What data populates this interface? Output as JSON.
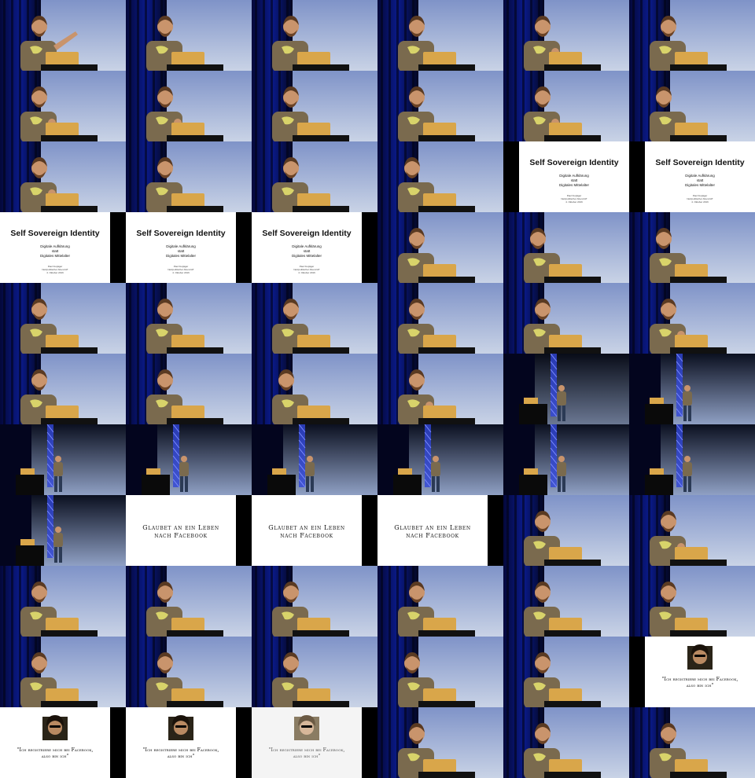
{
  "grid": {
    "columns": 6,
    "rows": 11
  },
  "slides": {
    "ssi": {
      "title": "Self Sovereign Identity",
      "subtitle_lines": [
        "Digitale Aufklärung",
        "statt",
        "Digitales Mittelalter"
      ],
      "meta_lines": [
        "Paul Fuxjäger",
        "Netzpolitischer Abend AT",
        "4. Oktober 2016"
      ]
    },
    "facebook_leben": {
      "lines": [
        "Glaubet an ein Leben",
        "nach Facebook"
      ]
    },
    "descartes": {
      "quote_lines": [
        "\"Ich registriere mich bei Facebook,",
        "also bin ich\""
      ]
    }
  },
  "frames": [
    {
      "kind": "speaker",
      "variant": "point"
    },
    {
      "kind": "speaker",
      "variant": "stand"
    },
    {
      "kind": "speaker",
      "variant": "stand"
    },
    {
      "kind": "speaker",
      "variant": "stand"
    },
    {
      "kind": "speaker",
      "variant": "gesture"
    },
    {
      "kind": "speaker",
      "variant": "stand"
    },
    {
      "kind": "speaker",
      "variant": "gesture"
    },
    {
      "kind": "speaker",
      "variant": "gesture"
    },
    {
      "kind": "speaker",
      "variant": "stand"
    },
    {
      "kind": "speaker",
      "variant": "stand"
    },
    {
      "kind": "speaker",
      "variant": "gesture"
    },
    {
      "kind": "speaker",
      "variant": "profile"
    },
    {
      "kind": "speaker",
      "variant": "gesture"
    },
    {
      "kind": "speaker",
      "variant": "stand"
    },
    {
      "kind": "speaker",
      "variant": "stand"
    },
    {
      "kind": "speaker",
      "variant": "profile"
    },
    {
      "kind": "slide",
      "slide": "ssi",
      "frame": "black-left"
    },
    {
      "kind": "slide",
      "slide": "ssi",
      "frame": "black-left"
    },
    {
      "kind": "slide",
      "slide": "ssi",
      "frame": "black-right"
    },
    {
      "kind": "slide",
      "slide": "ssi",
      "frame": "black-right"
    },
    {
      "kind": "slide",
      "slide": "ssi",
      "frame": "black-right"
    },
    {
      "kind": "speaker",
      "variant": "stand"
    },
    {
      "kind": "speaker",
      "variant": "profile"
    },
    {
      "kind": "speaker",
      "variant": "profile"
    },
    {
      "kind": "speaker",
      "variant": "stand"
    },
    {
      "kind": "speaker",
      "variant": "stand"
    },
    {
      "kind": "speaker",
      "variant": "stand"
    },
    {
      "kind": "speaker",
      "variant": "stand"
    },
    {
      "kind": "speaker",
      "variant": "stand"
    },
    {
      "kind": "speaker",
      "variant": "gesture"
    },
    {
      "kind": "speaker",
      "variant": "stand"
    },
    {
      "kind": "speaker",
      "variant": "stand"
    },
    {
      "kind": "speaker",
      "variant": "profile"
    },
    {
      "kind": "speaker",
      "variant": "gesture"
    },
    {
      "kind": "wide",
      "variant": "dim"
    },
    {
      "kind": "wide",
      "variant": "dark"
    },
    {
      "kind": "wide",
      "variant": "dark"
    },
    {
      "kind": "wide",
      "variant": "dark"
    },
    {
      "kind": "wide",
      "variant": "dark"
    },
    {
      "kind": "wide",
      "variant": "dark"
    },
    {
      "kind": "wide",
      "variant": "dark"
    },
    {
      "kind": "wide",
      "variant": "dark"
    },
    {
      "kind": "wide",
      "variant": "dark"
    },
    {
      "kind": "slide",
      "slide": "facebook_leben",
      "frame": "black-right"
    },
    {
      "kind": "slide",
      "slide": "facebook_leben",
      "frame": "black-right"
    },
    {
      "kind": "slide",
      "slide": "facebook_leben",
      "frame": "black-right"
    },
    {
      "kind": "speaker",
      "variant": "stand"
    },
    {
      "kind": "speaker",
      "variant": "gesture"
    },
    {
      "kind": "speaker",
      "variant": "stand"
    },
    {
      "kind": "speaker",
      "variant": "stand"
    },
    {
      "kind": "speaker",
      "variant": "stand"
    },
    {
      "kind": "speaker",
      "variant": "stand"
    },
    {
      "kind": "speaker",
      "variant": "stand"
    },
    {
      "kind": "speaker",
      "variant": "stand"
    },
    {
      "kind": "speaker",
      "variant": "stand"
    },
    {
      "kind": "speaker",
      "variant": "stand"
    },
    {
      "kind": "speaker",
      "variant": "stand"
    },
    {
      "kind": "speaker",
      "variant": "profile"
    },
    {
      "kind": "speaker",
      "variant": "stand"
    },
    {
      "kind": "slide",
      "slide": "descartes",
      "frame": "black-left"
    },
    {
      "kind": "slide",
      "slide": "descartes",
      "frame": "black-right"
    },
    {
      "kind": "slide",
      "slide": "descartes",
      "frame": "black-right"
    },
    {
      "kind": "slide",
      "slide": "descartes",
      "frame": "black-right-faded"
    },
    {
      "kind": "speaker",
      "variant": "stand"
    },
    {
      "kind": "speaker",
      "variant": "stand"
    },
    {
      "kind": "speaker",
      "variant": "stand"
    }
  ],
  "colors": {
    "curtain": "#0a1a8a",
    "sky_top": "#7f93c8",
    "sky_bottom": "#c9d3e6",
    "shirt": "#7a6a4e",
    "skin": "#c9946c",
    "laptop": "#d9a64a",
    "truss": "#3146d8"
  }
}
